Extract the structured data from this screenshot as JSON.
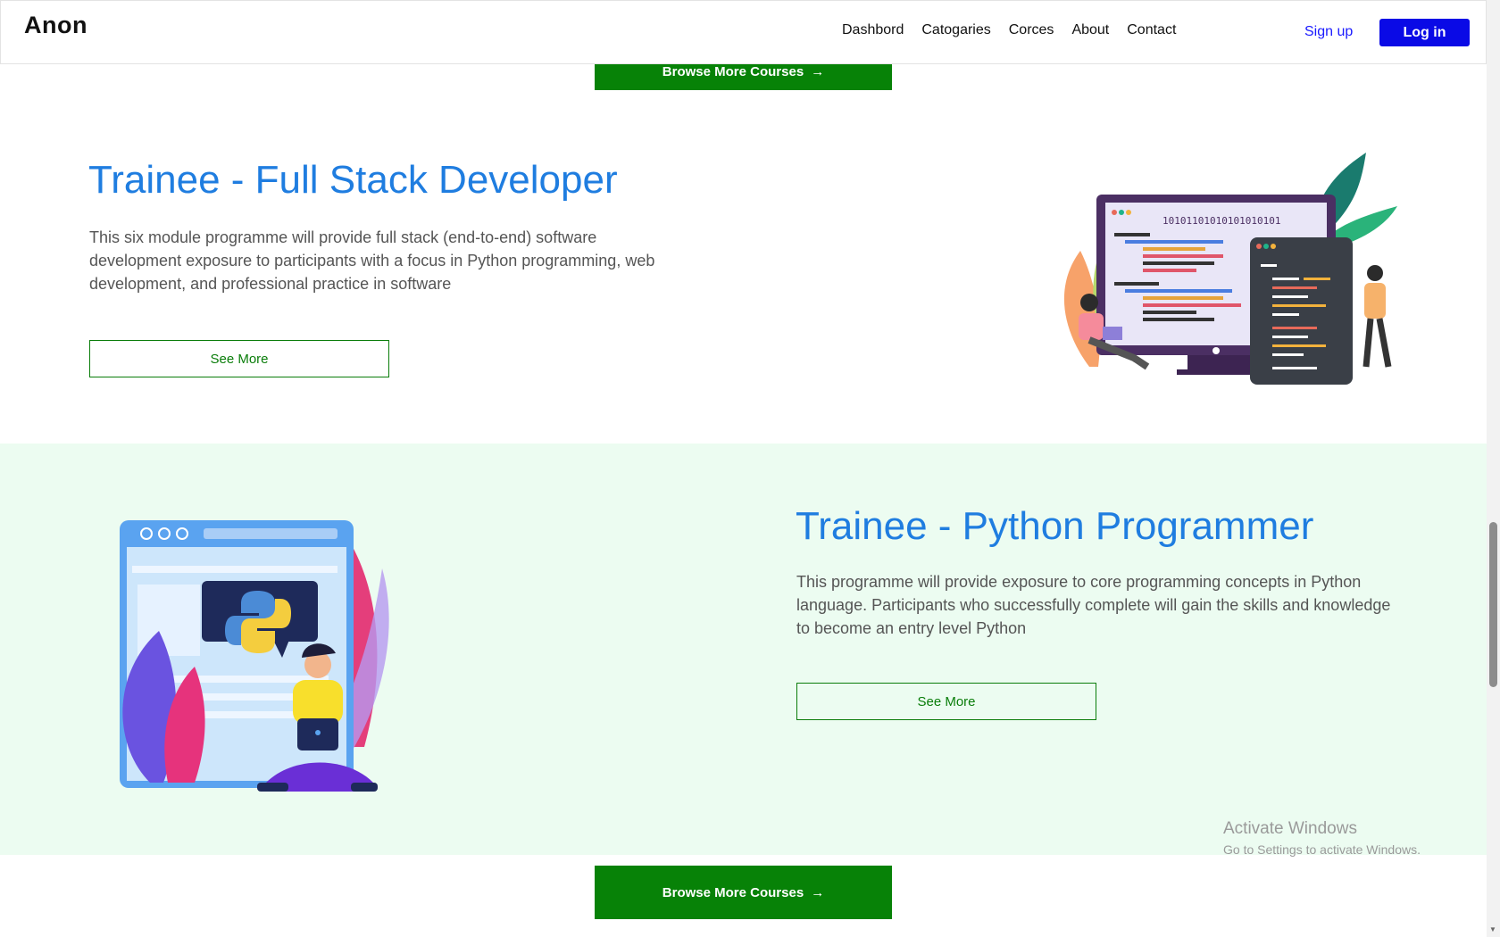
{
  "nav": {
    "brand": "Anon",
    "links": [
      "Dashbord",
      "Catogaries",
      "Corces",
      "About",
      "Contact"
    ],
    "signup": "Sign up",
    "login": "Log in"
  },
  "browse": {
    "label": "Browse More Courses",
    "arrow": "→"
  },
  "courses": [
    {
      "title": "Trainee - Full Stack Developer",
      "description": "This six module programme will provide full stack (end-to-end) software development exposure to participants with a focus in Python programming, web development, and professional practice in software",
      "button": "See More",
      "binary_text": "10101101010101010101"
    },
    {
      "title": "Trainee - Python Programmer",
      "description": "This programme will provide exposure to core programming concepts in Python language. Participants who successfully complete will gain the skills and knowledge to become an entry level Python",
      "button": "See More"
    }
  ],
  "watermark": {
    "title": "Activate Windows",
    "subtitle": "Go to Settings to activate Windows."
  },
  "colors": {
    "accent_blue": "#1f7de0",
    "green": "#078207",
    "section_bg": "#ecfcf1",
    "login_blue": "#0a0ae6"
  }
}
